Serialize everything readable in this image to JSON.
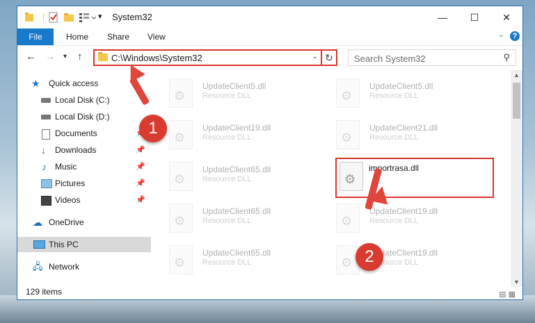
{
  "window": {
    "title": "System32",
    "controls": {
      "minimize": "—",
      "maximize": "☐",
      "close": "✕"
    }
  },
  "ribbon": {
    "tabs": [
      {
        "label": "File"
      },
      {
        "label": "Home"
      },
      {
        "label": "Share"
      },
      {
        "label": "View"
      }
    ],
    "help": "?"
  },
  "navigation": {
    "address": "C:\\Windows\\System32",
    "search_placeholder": "Search System32"
  },
  "sidebar": {
    "items": [
      {
        "label": "Quick access",
        "icon": "star-icon"
      },
      {
        "label": "Local Disk (C:)",
        "icon": "drive-icon"
      },
      {
        "label": "Local Disk (D:)",
        "icon": "drive-icon"
      },
      {
        "label": "Documents",
        "icon": "documents-icon",
        "pinned": true
      },
      {
        "label": "Downloads",
        "icon": "downloads-icon",
        "pinned": true
      },
      {
        "label": "Music",
        "icon": "music-icon",
        "pinned": true
      },
      {
        "label": "Pictures",
        "icon": "pictures-icon",
        "pinned": true
      },
      {
        "label": "Videos",
        "icon": "videos-icon",
        "pinned": true
      },
      {
        "label": "OneDrive",
        "icon": "cloud-icon"
      },
      {
        "label": "This PC",
        "icon": "computer-icon",
        "selected": true
      },
      {
        "label": "Network",
        "icon": "network-icon"
      }
    ]
  },
  "files": [
    {
      "name": "UpdateClient5.dll",
      "type": "Resource DLL"
    },
    {
      "name": "UpdateClient5.dll",
      "type": "Resource DLL"
    },
    {
      "name": "UpdateClient19.dll",
      "type": "Resource DLL"
    },
    {
      "name": "UpdateClient21.dll",
      "type": "Resource DLL"
    },
    {
      "name": "UpdateClient65.dll",
      "type": "Resource DLL"
    },
    {
      "name": "importrasa.dll",
      "type": ""
    },
    {
      "name": "UpdateClient65.dll",
      "type": "Resource DLL"
    },
    {
      "name": "UpdateClient19.dll",
      "type": "Resource DLL"
    },
    {
      "name": "UpdateClient65.dll",
      "type": "Resource DLL"
    },
    {
      "name": "UpdateClient19.dll",
      "type": "Resource DLL"
    }
  ],
  "status": {
    "item_count": "129 items"
  },
  "annotations": {
    "step1": "1",
    "step2": "2",
    "accent": "#d9342b"
  }
}
